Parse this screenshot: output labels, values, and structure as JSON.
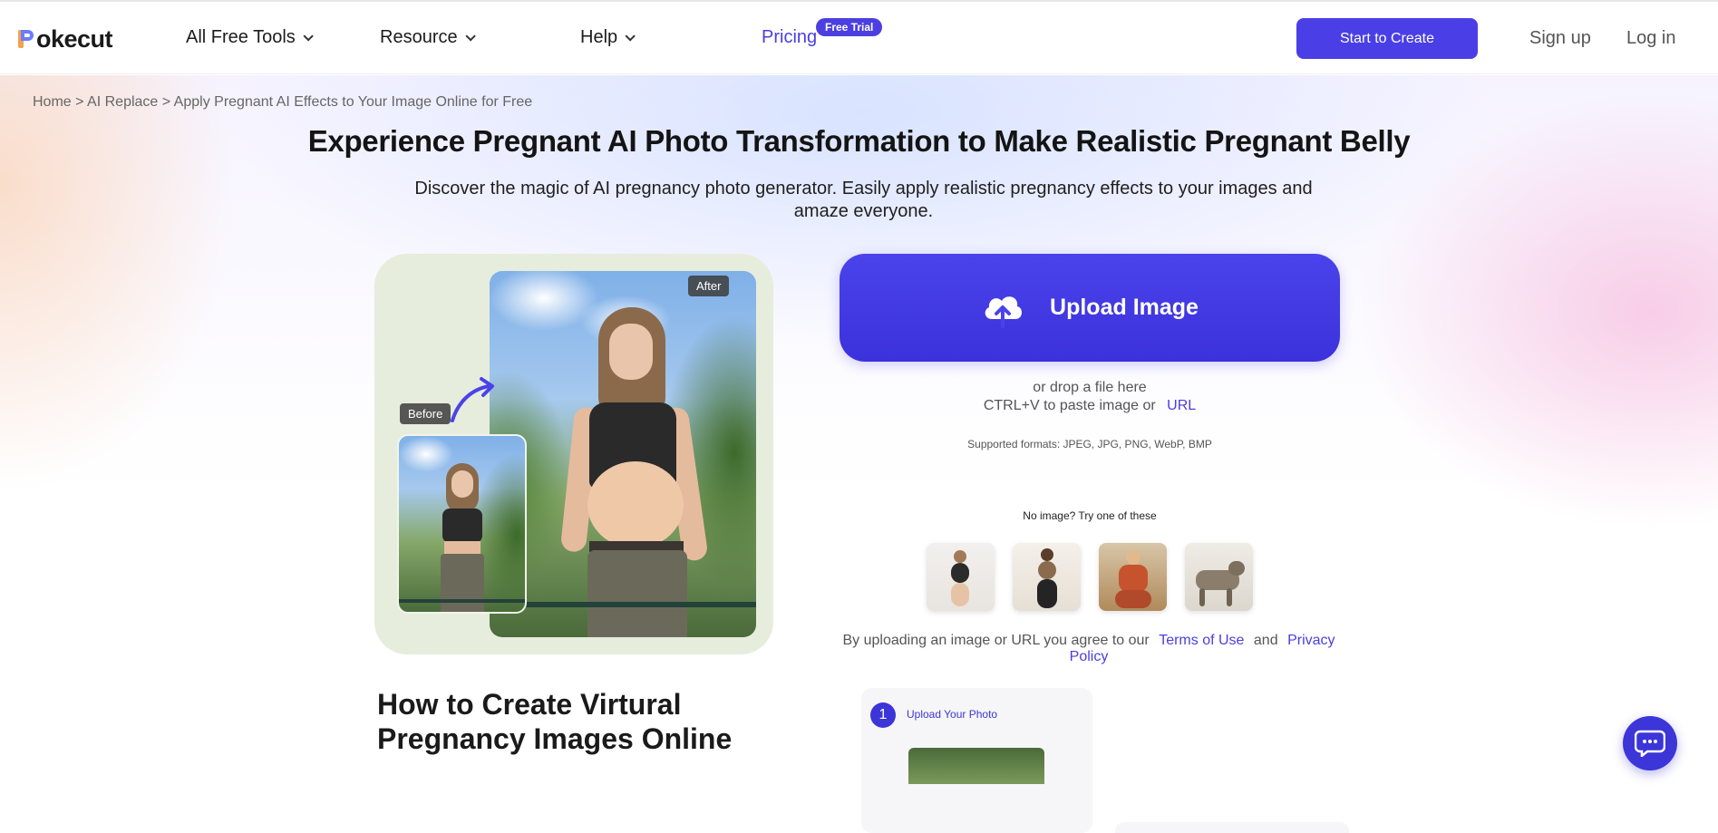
{
  "header": {
    "logo_text": "okecut",
    "nav": [
      {
        "label": "All Free Tools"
      },
      {
        "label": "Resource"
      },
      {
        "label": "Help"
      }
    ],
    "pricing_label": "Pricing",
    "free_trial_badge": "Free Trial",
    "start_button": "Start to Create",
    "signup": "Sign up",
    "login": "Log in"
  },
  "breadcrumb": {
    "home": "Home",
    "sep": ">",
    "parent": "AI Replace",
    "current": "Apply Pregnant AI Effects to Your Image Online for Free"
  },
  "hero": {
    "title": "Experience Pregnant AI Photo Transformation to Make Realistic Pregnant Belly",
    "subtitle": "Discover the magic of AI pregnancy photo generator. Easily apply realistic pregnancy effects to your images and amaze everyone.",
    "after_tag": "After",
    "before_tag": "Before"
  },
  "upload": {
    "button_label": "Upload Image",
    "drop_text": "or drop a file here",
    "paste_text": "CTRL+V to paste image or",
    "url_link": "URL",
    "formats": "Supported formats: JPEG, JPG, PNG, WebP, BMP",
    "try_text": "No image? Try one of these",
    "agree_prefix": "By uploading an image or URL you agree to our",
    "terms": "Terms of Use",
    "and": "and",
    "privacy": "Privacy Policy"
  },
  "how_to": {
    "title": "How to Create Virtural Pregnancy Images Online",
    "step1_number": "1",
    "step1_label": "Upload Your Photo"
  },
  "colors": {
    "brand": "#4a3fe6",
    "link": "#4a3fe0"
  },
  "icons": [
    "chevron-down-icon",
    "cloud-upload-icon",
    "curved-arrow-icon",
    "chat-icon"
  ]
}
